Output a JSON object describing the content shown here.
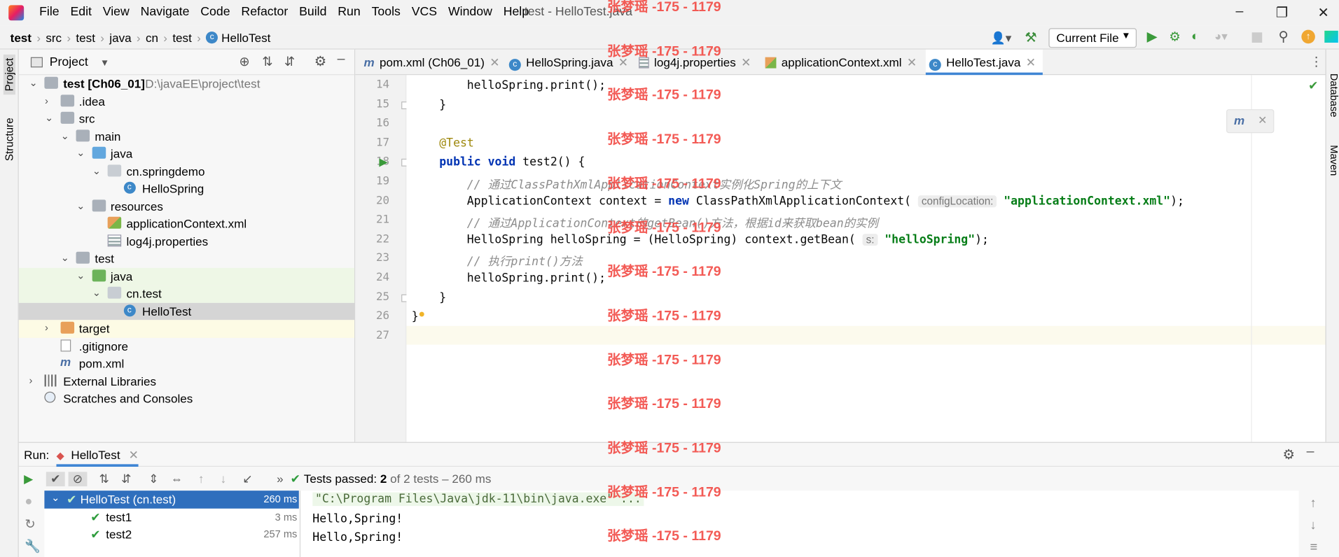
{
  "menu": {
    "items": [
      "File",
      "Edit",
      "View",
      "Navigate",
      "Code",
      "Refactor",
      "Build",
      "Run",
      "Tools",
      "VCS",
      "Window",
      "Help"
    ],
    "window_title": "test - HelloTest.java"
  },
  "breadcrumb": [
    "test",
    "src",
    "test",
    "java",
    "cn",
    "test",
    "HelloTest"
  ],
  "toolbar": {
    "run_config": "Current File"
  },
  "side_stripes": {
    "project": "Project",
    "structure": "Structure",
    "database": "Database",
    "maven": "Maven"
  },
  "project_panel": {
    "title": "Project",
    "tree": [
      {
        "label": "test [Ch06_01]",
        "extra": "D:\\javaEE\\project\\test",
        "depth": 0,
        "arrow": "down",
        "icon": "folder"
      },
      {
        "label": ".idea",
        "depth": 1,
        "arrow": "right",
        "icon": "folder"
      },
      {
        "label": "src",
        "depth": 1,
        "arrow": "down",
        "icon": "folder"
      },
      {
        "label": "main",
        "depth": 2,
        "arrow": "down",
        "icon": "folder"
      },
      {
        "label": "java",
        "depth": 3,
        "arrow": "down",
        "icon": "folder-blue"
      },
      {
        "label": "cn.springdemo",
        "depth": 4,
        "arrow": "down",
        "icon": "package"
      },
      {
        "label": "HelloSpring",
        "depth": 5,
        "arrow": "",
        "icon": "class"
      },
      {
        "label": "resources",
        "depth": 3,
        "arrow": "down",
        "icon": "folder-res"
      },
      {
        "label": "applicationContext.xml",
        "depth": 4,
        "arrow": "",
        "icon": "xml"
      },
      {
        "label": "log4j.properties",
        "depth": 4,
        "arrow": "",
        "icon": "props"
      },
      {
        "label": "test",
        "depth": 2,
        "arrow": "down",
        "icon": "folder"
      },
      {
        "label": "java",
        "depth": 3,
        "arrow": "down",
        "icon": "folder-green"
      },
      {
        "label": "cn.test",
        "depth": 4,
        "arrow": "down",
        "icon": "package"
      },
      {
        "label": "HelloTest",
        "depth": 5,
        "arrow": "",
        "icon": "class"
      },
      {
        "label": "target",
        "depth": 1,
        "arrow": "right",
        "icon": "folder-orange"
      },
      {
        "label": ".gitignore",
        "depth": 1,
        "arrow": "",
        "icon": "file"
      },
      {
        "label": "pom.xml",
        "depth": 1,
        "arrow": "",
        "icon": "maven"
      },
      {
        "label": "External Libraries",
        "depth": 0,
        "arrow": "right",
        "icon": "library"
      },
      {
        "label": "Scratches and Consoles",
        "depth": 0,
        "arrow": "",
        "icon": "scratch"
      }
    ]
  },
  "editor_tabs": [
    {
      "label": "pom.xml (Ch06_01)",
      "icon": "maven"
    },
    {
      "label": "HelloSpring.java",
      "icon": "class"
    },
    {
      "label": "log4j.properties",
      "icon": "props"
    },
    {
      "label": "applicationContext.xml",
      "icon": "xml"
    },
    {
      "label": "HelloTest.java",
      "icon": "class",
      "active": true
    }
  ],
  "editor": {
    "line_numbers": [
      "14",
      "15",
      "16",
      "17",
      "18",
      "19",
      "20",
      "21",
      "22",
      "23",
      "24",
      "25",
      "26",
      "27"
    ],
    "lines": {
      "l14": "helloSpring.print();",
      "l15": "}",
      "l17": "@Test",
      "l18_kw": "public void",
      "l18_rest": " test2() {",
      "l19": "// 通过ClassPathXmlApplicationContext实例化Spring的上下文",
      "l20_a": "ApplicationContext context = ",
      "l20_kw": "new",
      "l20_b": " ClassPathXmlApplicationContext(",
      "l20_hint": "configLocation:",
      "l20_str": "\"applicationContext.xml\"",
      "l20_end": ");",
      "l21": "// 通过ApplicationContext的getBean()方法，根据id来获取bean的实例",
      "l22_a": "HelloSpring helloSpring = (HelloSpring) context.getBean(",
      "l22_hint": "s:",
      "l22_str": "\"helloSpring\"",
      "l22_end": ");",
      "l23": "// 执行print()方法",
      "l24": "helloSpring.print();",
      "l25": "}",
      "l26": "}"
    }
  },
  "run_panel": {
    "label": "Run:",
    "tab": "HelloTest",
    "status_prefix": "Tests passed:",
    "status_count": "2",
    "status_suffix": "of 2 tests – 260 ms",
    "tests": [
      {
        "name": "HelloTest (cn.test)",
        "time": "260 ms",
        "depth": 0
      },
      {
        "name": "test1",
        "time": "3 ms",
        "depth": 1
      },
      {
        "name": "test2",
        "time": "257 ms",
        "depth": 1
      }
    ],
    "console": [
      "\"C:\\Program Files\\Java\\jdk-11\\bin\\java.exe\" ...",
      "Hello,Spring!",
      "Hello,Spring!"
    ]
  },
  "watermark": "张梦瑶 -175 - 1179",
  "colors": {
    "accent": "#3f85d4",
    "selection": "#2f6fbd",
    "pass": "#2e9c3c",
    "watermark": "#f24a44"
  }
}
